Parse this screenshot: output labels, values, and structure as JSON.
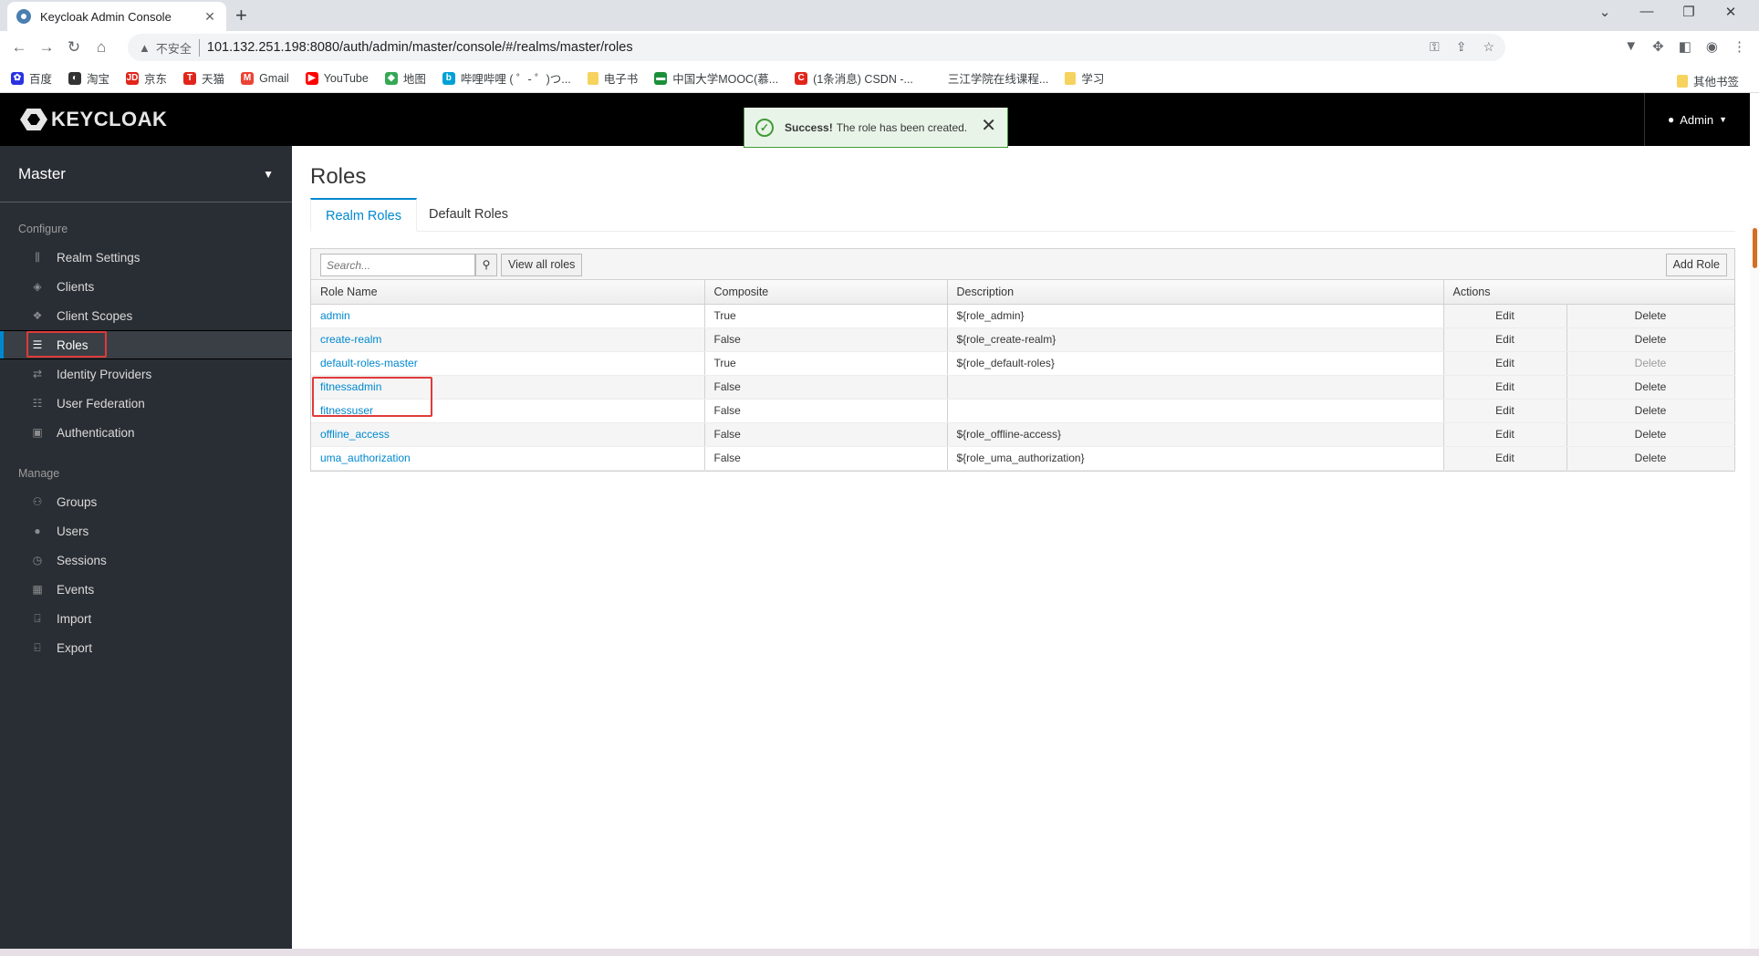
{
  "browser": {
    "tab_title": "Keycloak Admin Console",
    "tab_close": "✕",
    "new_tab": "+",
    "insecure_label": "不安全",
    "url": "101.132.251.198:8080/auth/admin/master/console/#/realms/master/roles",
    "bookmarks": [
      {
        "label": "百度",
        "color": "#2932e1",
        "glyph": "✿"
      },
      {
        "label": "淘宝",
        "color": "#333333",
        "glyph": "◐"
      },
      {
        "label": "京东",
        "color": "#e1251b",
        "glyph": "JD"
      },
      {
        "label": "天猫",
        "color": "#e1251b",
        "glyph": "T"
      },
      {
        "label": "Gmail",
        "color": "#ea4335",
        "glyph": "M"
      },
      {
        "label": "YouTube",
        "color": "#ff0000",
        "glyph": "▶"
      },
      {
        "label": "地图",
        "color": "#34a853",
        "glyph": "◆"
      },
      {
        "label": "哔哩哔哩 ( ゜- ゜)つ...",
        "color": "#00a1d6",
        "glyph": "b"
      },
      {
        "label": "电子书",
        "color": "#f6d35e",
        "glyph": ""
      },
      {
        "label": "中国大学MOOC(慕...",
        "color": "#1b8f3a",
        "glyph": "▬"
      },
      {
        "label": "(1条消息) CSDN -...",
        "color": "#e1251b",
        "glyph": "C"
      },
      {
        "label": "三江学院在线课程...",
        "color": "#ffffff",
        "glyph": ""
      },
      {
        "label": "学习",
        "color": "#f6d35e",
        "glyph": ""
      }
    ],
    "other_bookmarks": "其他书签"
  },
  "header": {
    "logo_text": "KEYCLOAK",
    "user_label": "Admin"
  },
  "toast": {
    "strong": "Success!",
    "message": "The role has been created."
  },
  "sidebar": {
    "realm": "Master",
    "configure_label": "Configure",
    "configure_items": [
      {
        "label": "Realm Settings",
        "icon": "sliders-icon",
        "glyph": "⫼"
      },
      {
        "label": "Clients",
        "icon": "cube-icon",
        "glyph": "◈"
      },
      {
        "label": "Client Scopes",
        "icon": "cubes-icon",
        "glyph": "❖"
      },
      {
        "label": "Roles",
        "icon": "list-icon",
        "glyph": "☰",
        "active": true
      },
      {
        "label": "Identity Providers",
        "icon": "exchange-icon",
        "glyph": "⇄"
      },
      {
        "label": "User Federation",
        "icon": "database-icon",
        "glyph": "☷"
      },
      {
        "label": "Authentication",
        "icon": "lock-icon",
        "glyph": "▣"
      }
    ],
    "manage_label": "Manage",
    "manage_items": [
      {
        "label": "Groups",
        "icon": "users-icon",
        "glyph": "⚇"
      },
      {
        "label": "Users",
        "icon": "user-icon",
        "glyph": "●"
      },
      {
        "label": "Sessions",
        "icon": "clock-icon",
        "glyph": "◷"
      },
      {
        "label": "Events",
        "icon": "calendar-icon",
        "glyph": "▦"
      },
      {
        "label": "Import",
        "icon": "import-icon",
        "glyph": "⍈"
      },
      {
        "label": "Export",
        "icon": "export-icon",
        "glyph": "⍇"
      }
    ]
  },
  "main": {
    "title": "Roles",
    "tabs": [
      "Realm Roles",
      "Default Roles"
    ],
    "search_placeholder": "Search...",
    "view_all_label": "View all roles",
    "add_role_label": "Add Role",
    "columns": [
      "Role Name",
      "Composite",
      "Description",
      "Actions"
    ],
    "rows": [
      {
        "name": "admin",
        "composite": "True",
        "description": "${role_admin}",
        "edit": "Edit",
        "delete": "Delete",
        "delete_disabled": false
      },
      {
        "name": "create-realm",
        "composite": "False",
        "description": "${role_create-realm}",
        "edit": "Edit",
        "delete": "Delete",
        "delete_disabled": false
      },
      {
        "name": "default-roles-master",
        "composite": "True",
        "description": "${role_default-roles}",
        "edit": "Edit",
        "delete": "Delete",
        "delete_disabled": true
      },
      {
        "name": "fitnessadmin",
        "composite": "False",
        "description": "",
        "edit": "Edit",
        "delete": "Delete",
        "delete_disabled": false
      },
      {
        "name": "fitnessuser",
        "composite": "False",
        "description": "",
        "edit": "Edit",
        "delete": "Delete",
        "delete_disabled": false
      },
      {
        "name": "offline_access",
        "composite": "False",
        "description": "${role_offline-access}",
        "edit": "Edit",
        "delete": "Delete",
        "delete_disabled": false
      },
      {
        "name": "uma_authorization",
        "composite": "False",
        "description": "${role_uma_authorization}",
        "edit": "Edit",
        "delete": "Delete",
        "delete_disabled": false
      }
    ]
  },
  "colors": {
    "accent": "#0088ce",
    "success": "#3f9c35",
    "sidebar": "#292e34",
    "highlight": "#e03a3a"
  }
}
